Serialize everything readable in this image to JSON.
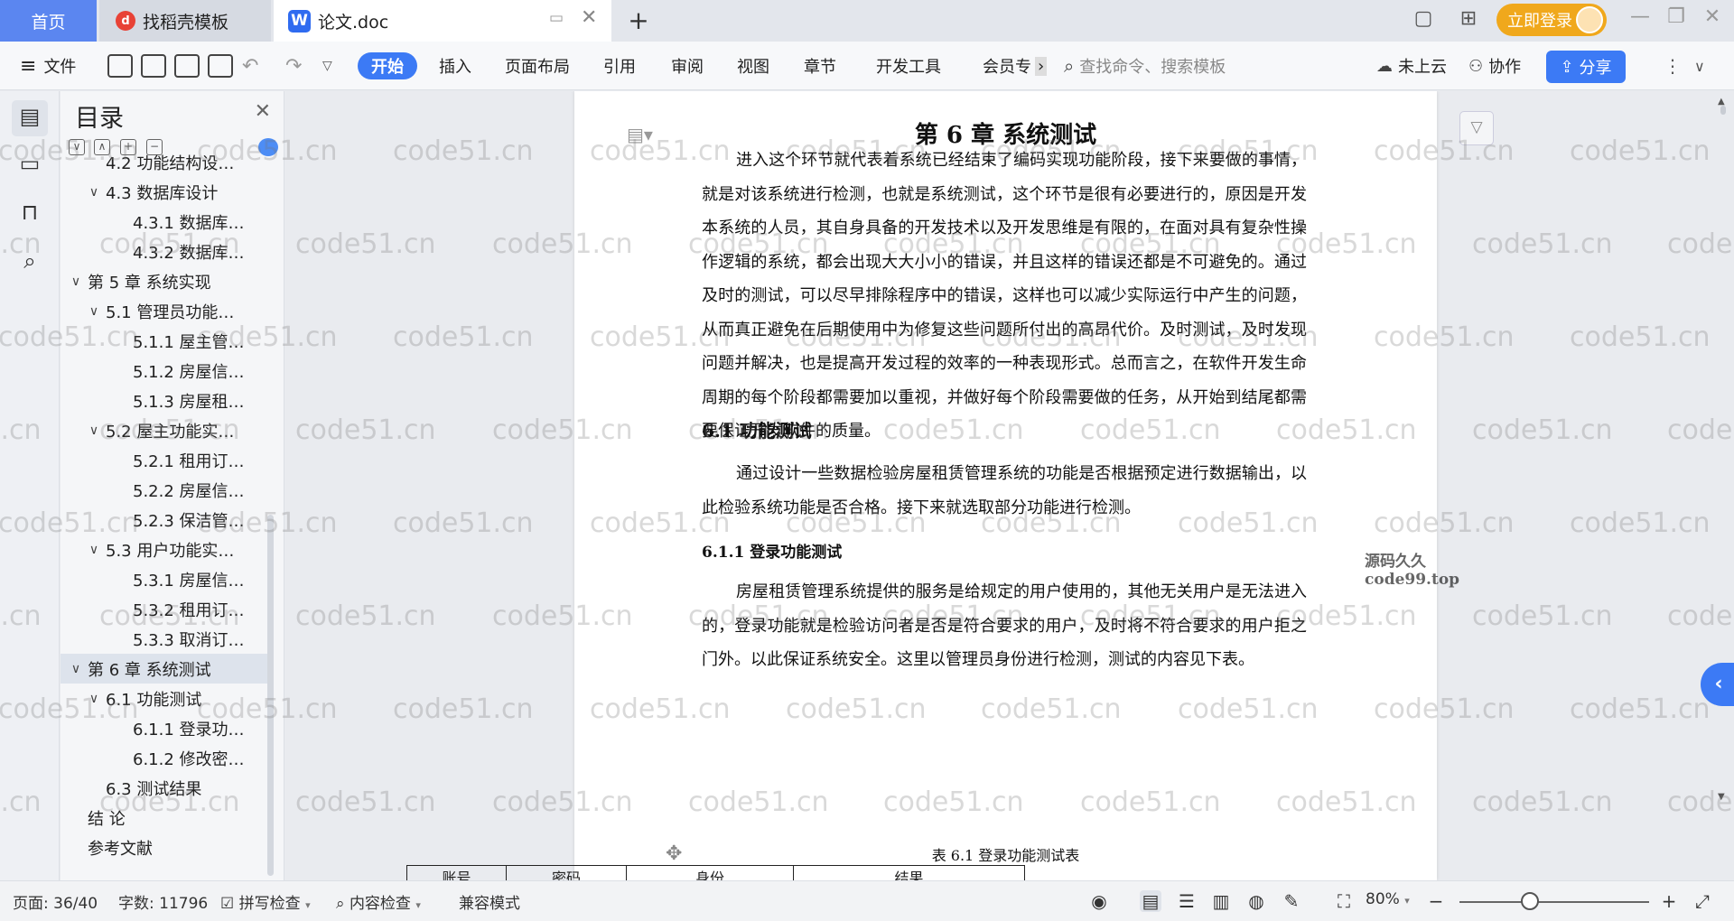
{
  "tabs": {
    "home": "首页",
    "template": "找稻壳模板",
    "doc": "论文.doc",
    "add_icon": "plus-icon"
  },
  "header": {
    "login_label": "立即登录"
  },
  "toolbar": {
    "file": "文件",
    "start": "开始",
    "insert": "插入",
    "layout": "页面布局",
    "reference": "引用",
    "review": "审阅",
    "view": "视图",
    "chapter": "章节",
    "devtools": "开发工具",
    "member": "会员专",
    "search_placeholder": "查找命令、搜索模板",
    "cloud": "未上云",
    "collab": "协作",
    "share": "分享"
  },
  "toc": {
    "title": "目录",
    "items": [
      {
        "label": "4.2  功能结构设…",
        "level": 2,
        "caret": "",
        "selected": false
      },
      {
        "label": "4.3  数据库设计",
        "level": 2,
        "caret": "∨",
        "selected": false
      },
      {
        "label": "4.3.1  数据库…",
        "level": 3,
        "caret": "",
        "selected": false
      },
      {
        "label": "4.3.2  数据库…",
        "level": 3,
        "caret": "",
        "selected": false
      },
      {
        "label": "第 5 章  系统实现",
        "level": 1,
        "caret": "∨",
        "selected": false
      },
      {
        "label": "5.1  管理员功能…",
        "level": 2,
        "caret": "∨",
        "selected": false
      },
      {
        "label": "5.1.1  屋主管…",
        "level": 3,
        "caret": "",
        "selected": false
      },
      {
        "label": "5.1.2  房屋信…",
        "level": 3,
        "caret": "",
        "selected": false
      },
      {
        "label": "5.1.3  房屋租…",
        "level": 3,
        "caret": "",
        "selected": false
      },
      {
        "label": "5.2  屋主功能实…",
        "level": 2,
        "caret": "∨",
        "selected": false
      },
      {
        "label": "5.2.1  租用订…",
        "level": 3,
        "caret": "",
        "selected": false
      },
      {
        "label": "5.2.2  房屋信…",
        "level": 3,
        "caret": "",
        "selected": false
      },
      {
        "label": "5.2.3  保洁管…",
        "level": 3,
        "caret": "",
        "selected": false
      },
      {
        "label": "5.3  用户功能实…",
        "level": 2,
        "caret": "∨",
        "selected": false
      },
      {
        "label": "5.3.1  房屋信…",
        "level": 3,
        "caret": "",
        "selected": false
      },
      {
        "label": "5.3.2  租用订…",
        "level": 3,
        "caret": "",
        "selected": false
      },
      {
        "label": "5.3.3  取消订…",
        "level": 3,
        "caret": "",
        "selected": false
      },
      {
        "label": "第 6 章  系统测试",
        "level": 1,
        "caret": "∨",
        "selected": true
      },
      {
        "label": "6.1  功能测试",
        "level": 2,
        "caret": "∨",
        "selected": false
      },
      {
        "label": "6.1.1  登录功…",
        "level": 3,
        "caret": "",
        "selected": false
      },
      {
        "label": "6.1.2  修改密…",
        "level": 3,
        "caret": "",
        "selected": false
      },
      {
        "label": "6.3  测试结果",
        "level": 2,
        "caret": "",
        "selected": false
      },
      {
        "label": "结    论",
        "level": 1,
        "caret": "",
        "selected": false
      },
      {
        "label": "参考文献",
        "level": 1,
        "caret": "",
        "selected": false
      }
    ]
  },
  "document": {
    "chapter_title": "第 6 章  系统测试",
    "para1": "进入这个环节就代表着系统已经结束了编码实现功能阶段，接下来要做的事情，就是对该系统进行检测，也就是系统测试，这个环节是很有必要进行的，原因是开发本系统的人员，其自身具备的开发技术以及开发思维是有限的，在面对具有复杂性操作逻辑的系统，都会出现大大小小的错误，并且这样的错误还都是不可避免的。通过及时的测试，可以尽早排除程序中的错误，这样也可以减少实际运行中产生的问题，从而真正避免在后期使用中为修复这些问题所付出的高昂代价。及时测试，及时发现问题并解决，也是提高开发过程的效率的一种表现形式。总而言之，在软件开发生命周期的每个阶段都需要加以重视，并做好每个阶段需要做的任务，从开始到结尾都需要保证开发软件的质量。",
    "inline_watermark": "源码久久 code99.top",
    "h2": "6.1  功能测试",
    "para2": "通过设计一些数据检验房屋租赁管理系统的功能是否根据预定进行数据输出，以此检验系统功能是否合格。接下来就选取部分功能进行检测。",
    "h3": "6.1.1  登录功能测试",
    "para3": "房屋租赁管理系统提供的服务是给规定的用户使用的，其他无关用户是无法进入的，登录功能就是检验访问者是否是符合要求的用户，及时将不符合要求的用户拒之门外。以此保证系统安全。这里以管理员身份进行检测，测试的内容见下表。",
    "table_caption": "表 6.1  登录功能测试表",
    "table_headers": [
      "账号",
      "密码",
      "身份",
      "结果"
    ]
  },
  "watermark": "code51.cn",
  "status": {
    "page": "页面: 36/40",
    "words": "字数: 11796",
    "spell": "拼写检查",
    "content_check": "内容检查",
    "compat": "兼容模式",
    "zoom": "80%"
  },
  "colors": {
    "accent": "#3c7af5",
    "home_tab": "#5b86f0",
    "login": "#f0a81c"
  }
}
